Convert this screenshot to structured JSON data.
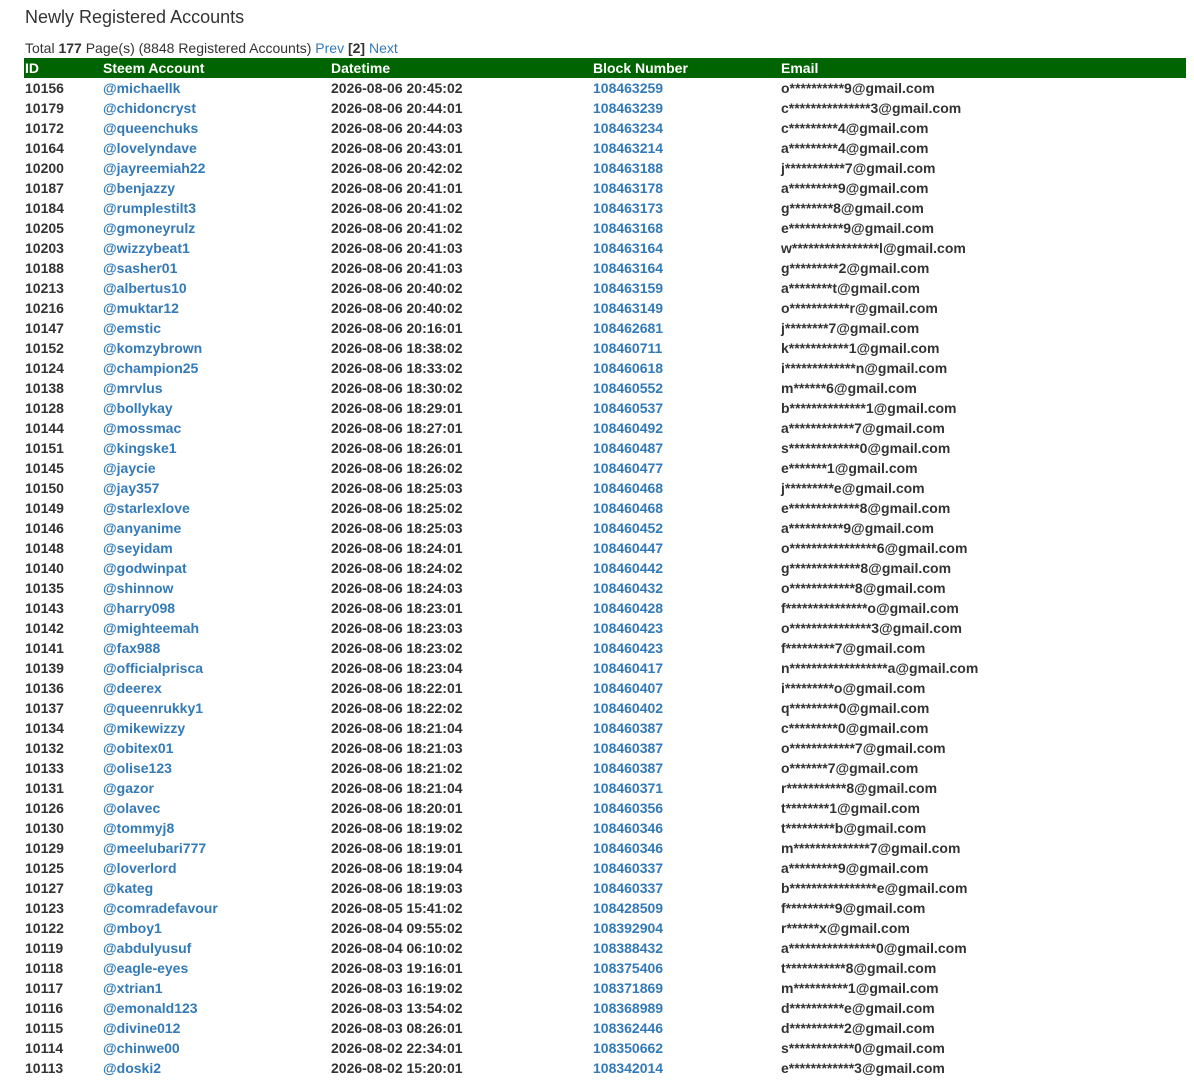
{
  "title": "Newly Registered Accounts",
  "summary": {
    "prefix": "Total ",
    "total_pages": "177",
    "pages_text": " Page(s) (8848 Registered Accounts) ",
    "prev_label": "Prev",
    "current_page": "[2]",
    "next_label": "Next"
  },
  "table": {
    "columns": [
      "ID",
      "Steem Account",
      "Datetime",
      "Block Number",
      "Email"
    ],
    "rows": [
      {
        "id": "10156",
        "account": "@michaellk",
        "datetime": "2026-08-06 20:45:02",
        "block": "108463259",
        "email": "o**********9@gmail.com"
      },
      {
        "id": "10179",
        "account": "@chidoncryst",
        "datetime": "2026-08-06 20:44:01",
        "block": "108463239",
        "email": "c***************3@gmail.com"
      },
      {
        "id": "10172",
        "account": "@queenchuks",
        "datetime": "2026-08-06 20:44:03",
        "block": "108463234",
        "email": "c*********4@gmail.com"
      },
      {
        "id": "10164",
        "account": "@lovelyndave",
        "datetime": "2026-08-06 20:43:01",
        "block": "108463214",
        "email": "a*********4@gmail.com"
      },
      {
        "id": "10200",
        "account": "@jayreemiah22",
        "datetime": "2026-08-06 20:42:02",
        "block": "108463188",
        "email": "j***********7@gmail.com"
      },
      {
        "id": "10187",
        "account": "@benjazzy",
        "datetime": "2026-08-06 20:41:01",
        "block": "108463178",
        "email": "a*********9@gmail.com"
      },
      {
        "id": "10184",
        "account": "@rumplestilt3",
        "datetime": "2026-08-06 20:41:02",
        "block": "108463173",
        "email": "g********8@gmail.com"
      },
      {
        "id": "10205",
        "account": "@gmoneyrulz",
        "datetime": "2026-08-06 20:41:02",
        "block": "108463168",
        "email": "e**********9@gmail.com"
      },
      {
        "id": "10203",
        "account": "@wizzybeat1",
        "datetime": "2026-08-06 20:41:03",
        "block": "108463164",
        "email": "w****************l@gmail.com"
      },
      {
        "id": "10188",
        "account": "@sasher01",
        "datetime": "2026-08-06 20:41:03",
        "block": "108463164",
        "email": "g*********2@gmail.com"
      },
      {
        "id": "10213",
        "account": "@albertus10",
        "datetime": "2026-08-06 20:40:02",
        "block": "108463159",
        "email": "a********t@gmail.com"
      },
      {
        "id": "10216",
        "account": "@muktar12",
        "datetime": "2026-08-06 20:40:02",
        "block": "108463149",
        "email": "o***********r@gmail.com"
      },
      {
        "id": "10147",
        "account": "@emstic",
        "datetime": "2026-08-06 20:16:01",
        "block": "108462681",
        "email": "j********7@gmail.com"
      },
      {
        "id": "10152",
        "account": "@komzybrown",
        "datetime": "2026-08-06 18:38:02",
        "block": "108460711",
        "email": "k***********1@gmail.com"
      },
      {
        "id": "10124",
        "account": "@champion25",
        "datetime": "2026-08-06 18:33:02",
        "block": "108460618",
        "email": "i*************n@gmail.com"
      },
      {
        "id": "10138",
        "account": "@mrvlus",
        "datetime": "2026-08-06 18:30:02",
        "block": "108460552",
        "email": "m******6@gmail.com"
      },
      {
        "id": "10128",
        "account": "@bollykay",
        "datetime": "2026-08-06 18:29:01",
        "block": "108460537",
        "email": "b**************1@gmail.com"
      },
      {
        "id": "10144",
        "account": "@mossmac",
        "datetime": "2026-08-06 18:27:01",
        "block": "108460492",
        "email": "a************7@gmail.com"
      },
      {
        "id": "10151",
        "account": "@kingske1",
        "datetime": "2026-08-06 18:26:01",
        "block": "108460487",
        "email": "s*************0@gmail.com"
      },
      {
        "id": "10145",
        "account": "@jaycie",
        "datetime": "2026-08-06 18:26:02",
        "block": "108460477",
        "email": "e*******1@gmail.com"
      },
      {
        "id": "10150",
        "account": "@jay357",
        "datetime": "2026-08-06 18:25:03",
        "block": "108460468",
        "email": "j*********e@gmail.com"
      },
      {
        "id": "10149",
        "account": "@starlexlove",
        "datetime": "2026-08-06 18:25:02",
        "block": "108460468",
        "email": "e*************8@gmail.com"
      },
      {
        "id": "10146",
        "account": "@anyanime",
        "datetime": "2026-08-06 18:25:03",
        "block": "108460452",
        "email": "a**********9@gmail.com"
      },
      {
        "id": "10148",
        "account": "@seyidam",
        "datetime": "2026-08-06 18:24:01",
        "block": "108460447",
        "email": "o****************6@gmail.com"
      },
      {
        "id": "10140",
        "account": "@godwinpat",
        "datetime": "2026-08-06 18:24:02",
        "block": "108460442",
        "email": "g*************8@gmail.com"
      },
      {
        "id": "10135",
        "account": "@shinnow",
        "datetime": "2026-08-06 18:24:03",
        "block": "108460432",
        "email": "o************8@gmail.com"
      },
      {
        "id": "10143",
        "account": "@harry098",
        "datetime": "2026-08-06 18:23:01",
        "block": "108460428",
        "email": "f***************o@gmail.com"
      },
      {
        "id": "10142",
        "account": "@mighteemah",
        "datetime": "2026-08-06 18:23:03",
        "block": "108460423",
        "email": "o***************3@gmail.com"
      },
      {
        "id": "10141",
        "account": "@fax988",
        "datetime": "2026-08-06 18:23:02",
        "block": "108460423",
        "email": "f*********7@gmail.com"
      },
      {
        "id": "10139",
        "account": "@officialprisca",
        "datetime": "2026-08-06 18:23:04",
        "block": "108460417",
        "email": "n******************a@gmail.com"
      },
      {
        "id": "10136",
        "account": "@deerex",
        "datetime": "2026-08-06 18:22:01",
        "block": "108460407",
        "email": "i*********o@gmail.com"
      },
      {
        "id": "10137",
        "account": "@queenrukky1",
        "datetime": "2026-08-06 18:22:02",
        "block": "108460402",
        "email": "q*********0@gmail.com"
      },
      {
        "id": "10134",
        "account": "@mikewizzy",
        "datetime": "2026-08-06 18:21:04",
        "block": "108460387",
        "email": "c*********0@gmail.com"
      },
      {
        "id": "10132",
        "account": "@obitex01",
        "datetime": "2026-08-06 18:21:03",
        "block": "108460387",
        "email": "o************7@gmail.com"
      },
      {
        "id": "10133",
        "account": "@olise123",
        "datetime": "2026-08-06 18:21:02",
        "block": "108460387",
        "email": "o*******7@gmail.com"
      },
      {
        "id": "10131",
        "account": "@gazor",
        "datetime": "2026-08-06 18:21:04",
        "block": "108460371",
        "email": "r***********8@gmail.com"
      },
      {
        "id": "10126",
        "account": "@olavec",
        "datetime": "2026-08-06 18:20:01",
        "block": "108460356",
        "email": "t********1@gmail.com"
      },
      {
        "id": "10130",
        "account": "@tommyj8",
        "datetime": "2026-08-06 18:19:02",
        "block": "108460346",
        "email": "t*********b@gmail.com"
      },
      {
        "id": "10129",
        "account": "@meelubari777",
        "datetime": "2026-08-06 18:19:01",
        "block": "108460346",
        "email": "m**************7@gmail.com"
      },
      {
        "id": "10125",
        "account": "@loverlord",
        "datetime": "2026-08-06 18:19:04",
        "block": "108460337",
        "email": "a*********9@gmail.com"
      },
      {
        "id": "10127",
        "account": "@kateg",
        "datetime": "2026-08-06 18:19:03",
        "block": "108460337",
        "email": "b****************e@gmail.com"
      },
      {
        "id": "10123",
        "account": "@comradefavour",
        "datetime": "2026-08-05 15:41:02",
        "block": "108428509",
        "email": "f*********9@gmail.com"
      },
      {
        "id": "10122",
        "account": "@mboy1",
        "datetime": "2026-08-04 09:55:02",
        "block": "108392904",
        "email": "r******x@gmail.com"
      },
      {
        "id": "10119",
        "account": "@abdulyusuf",
        "datetime": "2026-08-04 06:10:02",
        "block": "108388432",
        "email": "a****************0@gmail.com"
      },
      {
        "id": "10118",
        "account": "@eagle-eyes",
        "datetime": "2026-08-03 19:16:01",
        "block": "108375406",
        "email": "t***********8@gmail.com"
      },
      {
        "id": "10117",
        "account": "@xtrian1",
        "datetime": "2026-08-03 16:19:02",
        "block": "108371869",
        "email": "m**********1@gmail.com"
      },
      {
        "id": "10116",
        "account": "@emonald123",
        "datetime": "2026-08-03 13:54:02",
        "block": "108368989",
        "email": "d**********e@gmail.com"
      },
      {
        "id": "10115",
        "account": "@divine012",
        "datetime": "2026-08-03 08:26:01",
        "block": "108362446",
        "email": "d**********2@gmail.com"
      },
      {
        "id": "10114",
        "account": "@chinwe00",
        "datetime": "2026-08-02 22:34:01",
        "block": "108350662",
        "email": "s************0@gmail.com"
      },
      {
        "id": "10113",
        "account": "@doski2",
        "datetime": "2026-08-02 15:20:01",
        "block": "108342014",
        "email": "e************3@gmail.com"
      }
    ]
  },
  "colors": {
    "header_bg": "#006400",
    "header_text": "#ffffff",
    "link": "#337ab7",
    "text": "#333333"
  }
}
